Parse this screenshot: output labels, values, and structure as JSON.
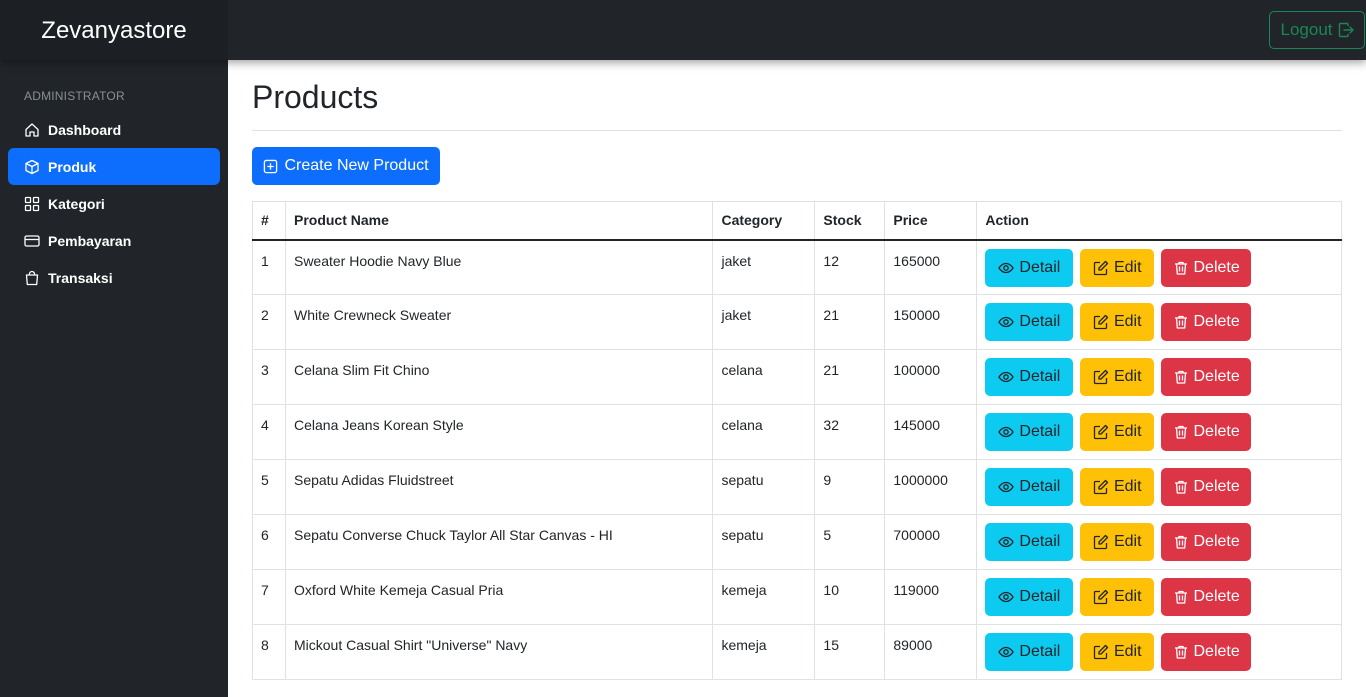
{
  "app": {
    "brand": "Zevanyastore"
  },
  "header": {
    "logout_label": "Logout",
    "logout_color": "#198754"
  },
  "sidebar": {
    "heading": "ADMINISTRATOR",
    "items": [
      {
        "label": "Dashboard",
        "icon": "house-icon",
        "active": false
      },
      {
        "label": "Produk",
        "icon": "box-icon",
        "active": true
      },
      {
        "label": "Kategori",
        "icon": "grid-icon",
        "active": false
      },
      {
        "label": "Pembayaran",
        "icon": "credit-card-icon",
        "active": false
      },
      {
        "label": "Transaksi",
        "icon": "bag-icon",
        "active": false
      }
    ]
  },
  "main": {
    "title": "Products",
    "create_label": "Create New Product",
    "table": {
      "headers": [
        "#",
        "Product Name",
        "Category",
        "Stock",
        "Price",
        "Action"
      ],
      "rows": [
        {
          "no": "1",
          "name": "Sweater Hoodie Navy Blue",
          "category": "jaket",
          "stock": "12",
          "price": "165000"
        },
        {
          "no": "2",
          "name": "White Crewneck Sweater",
          "category": "jaket",
          "stock": "21",
          "price": "150000"
        },
        {
          "no": "3",
          "name": "Celana Slim Fit Chino",
          "category": "celana",
          "stock": "21",
          "price": "100000"
        },
        {
          "no": "4",
          "name": "Celana Jeans Korean Style",
          "category": "celana",
          "stock": "32",
          "price": "145000"
        },
        {
          "no": "5",
          "name": "Sepatu Adidas Fluidstreet",
          "category": "sepatu",
          "stock": "9",
          "price": "1000000"
        },
        {
          "no": "6",
          "name": "Sepatu Converse Chuck Taylor All Star Canvas - HI",
          "category": "sepatu",
          "stock": "5",
          "price": "700000"
        },
        {
          "no": "7",
          "name": "Oxford White Kemeja Casual Pria",
          "category": "kemeja",
          "stock": "10",
          "price": "119000"
        },
        {
          "no": "8",
          "name": "Mickout Casual Shirt \"Universe\" Navy",
          "category": "kemeja",
          "stock": "15",
          "price": "89000"
        }
      ],
      "actions": {
        "detail_label": "Detail",
        "edit_label": "Edit",
        "delete_label": "Delete"
      }
    }
  },
  "colors": {
    "primary": "#0d6efd",
    "info": "#0dcaf0",
    "warning": "#ffc107",
    "danger": "#dc3545",
    "sidebar_bg": "#212529"
  }
}
